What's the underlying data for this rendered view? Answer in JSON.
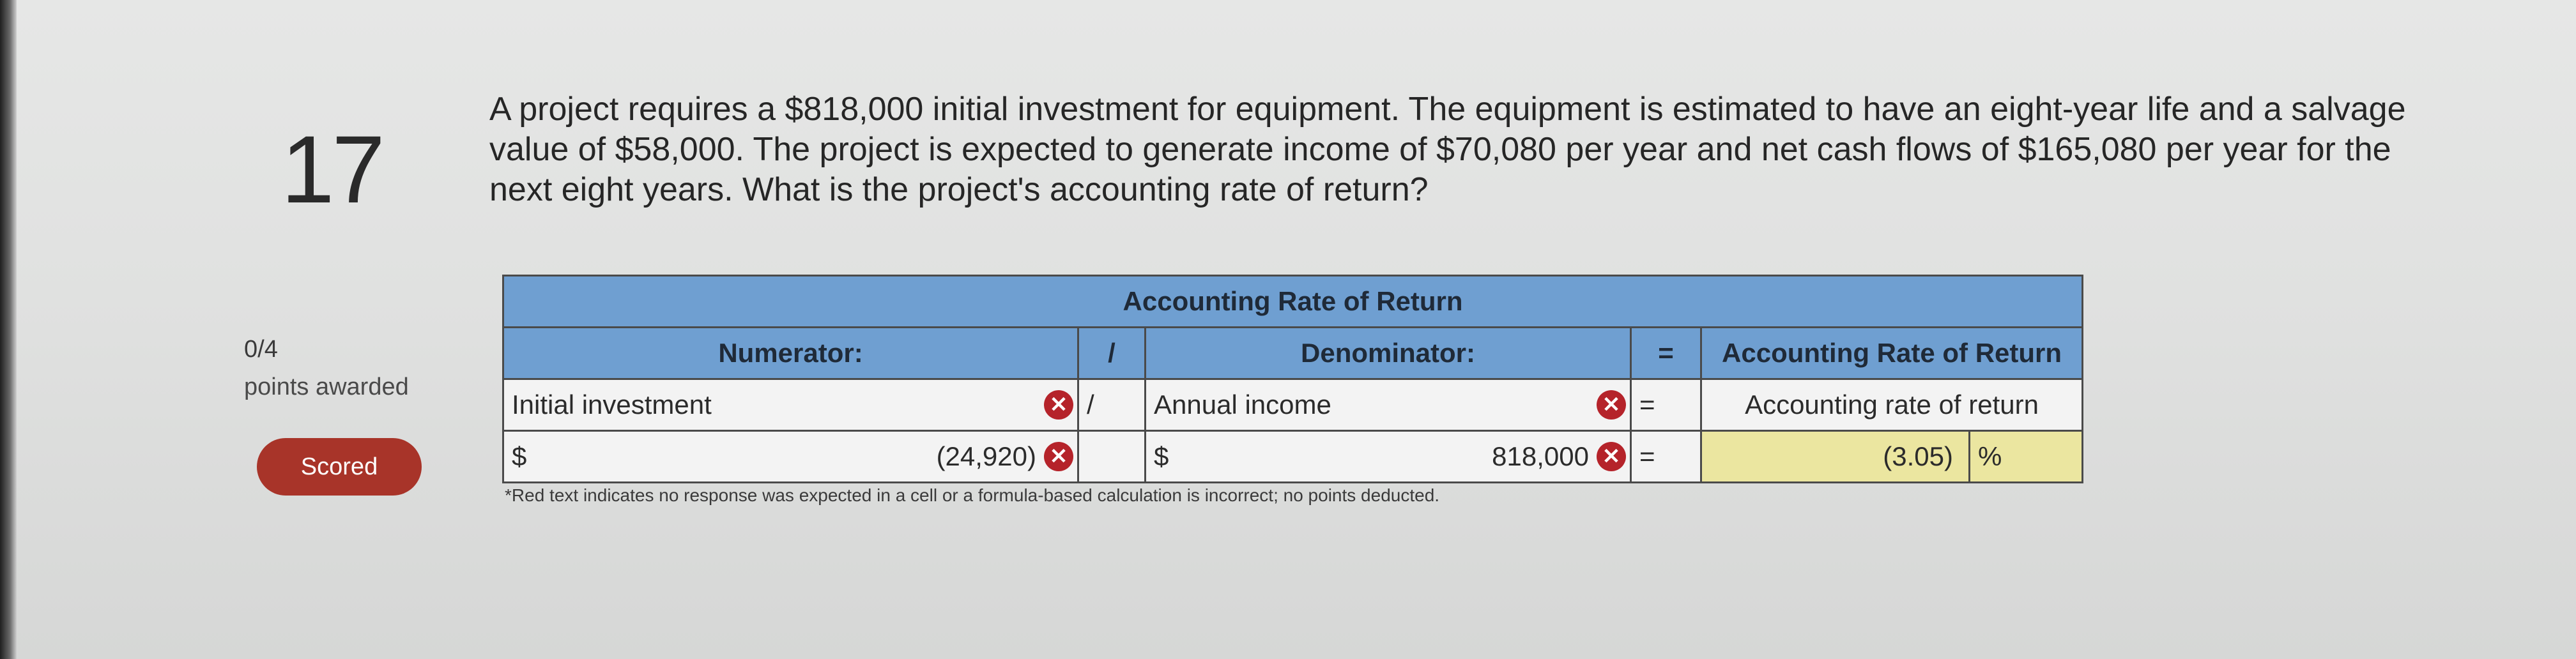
{
  "question": {
    "number": "17",
    "lines": [
      "A project requires a $818,000 initial investment for equipment. The equipment is estimated to have an eight-year life and a salvage",
      "value of $58,000. The project is expected to generate income of $70,080 per year and net cash flows of $165,080 per year for the",
      "next eight years. What is the project's accounting rate of return?"
    ]
  },
  "status": {
    "points": "0/4",
    "points_label": "points awarded",
    "scored_label": "Scored"
  },
  "table": {
    "title": "Accounting Rate of Return",
    "headers": {
      "numerator": "Numerator:",
      "divide": "/",
      "denominator": "Denominator:",
      "equals": "=",
      "result": "Accounting Rate of Return"
    },
    "labels": {
      "numerator": "Initial investment",
      "divide": "/",
      "denominator": "Annual income",
      "equals": "=",
      "result": "Accounting rate of return"
    },
    "values": {
      "numerator_currency": "$",
      "numerator_value": "(24,920)",
      "denominator_currency": "$",
      "denominator_value": "818,000",
      "equals": "=",
      "result_value": "(3.05)",
      "result_unit": "%"
    },
    "incorrect_mark": "✕"
  },
  "footnote": "*Red text indicates no response was expected in a cell or a formula-based calculation is incorrect; no points deducted."
}
